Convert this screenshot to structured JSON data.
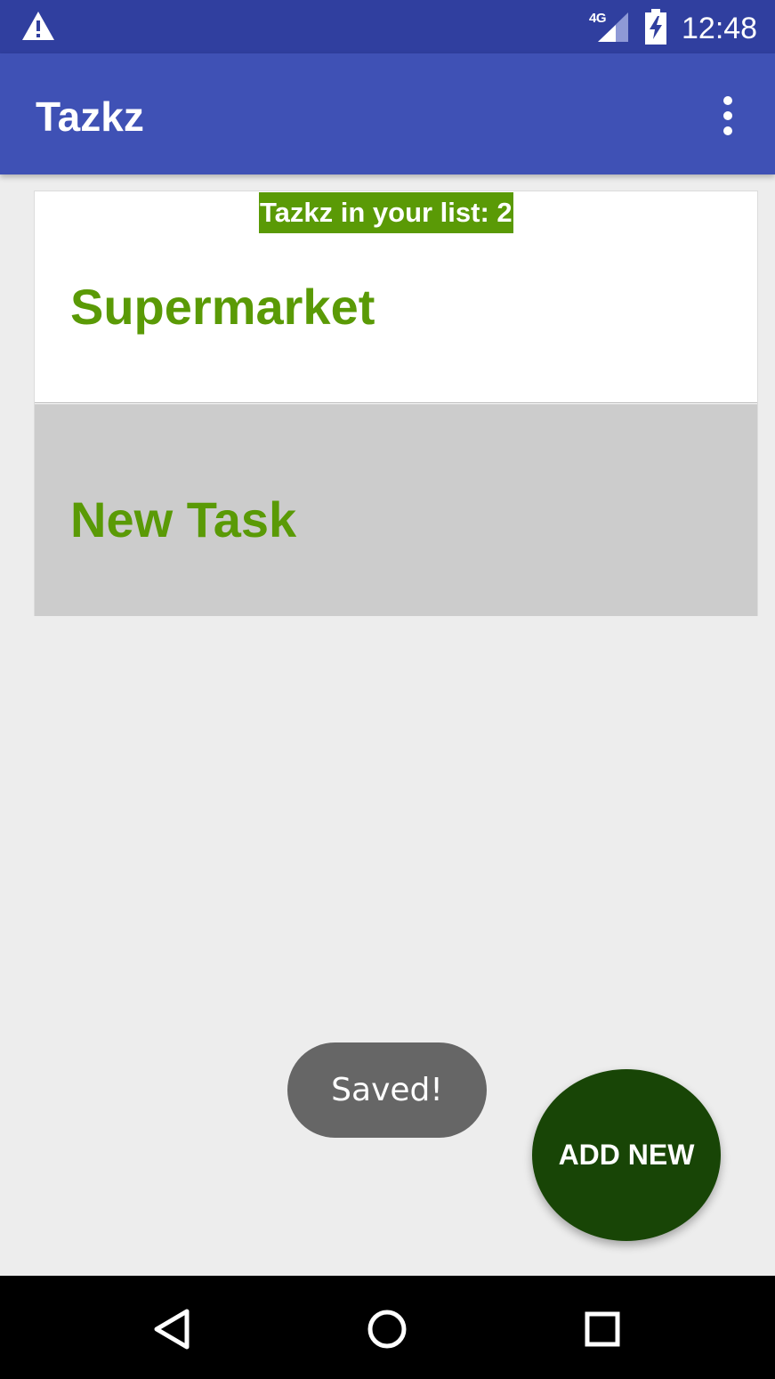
{
  "status_bar": {
    "network_label": "4G",
    "time": "12:48",
    "icons": [
      "warning-icon",
      "signal-icon",
      "battery-charging-icon"
    ]
  },
  "app_bar": {
    "title": "Tazkz",
    "overflow_icon": "more-vert-icon"
  },
  "list": {
    "count_label": "Tazkz in your list: 2",
    "items": [
      {
        "title": "Supermarket"
      },
      {
        "title": "New Task"
      }
    ]
  },
  "toast": {
    "message": "Saved!"
  },
  "fab": {
    "label": "ADD NEW"
  },
  "nav_bar": {
    "icons": [
      "back-icon",
      "home-icon",
      "recents-icon"
    ]
  },
  "colors": {
    "status_bar": "#303f9f",
    "app_bar": "#3f51b5",
    "accent_green": "#5a9a06",
    "fab": "#184506",
    "selected_row": "#cccccc",
    "toast": "#666666"
  }
}
